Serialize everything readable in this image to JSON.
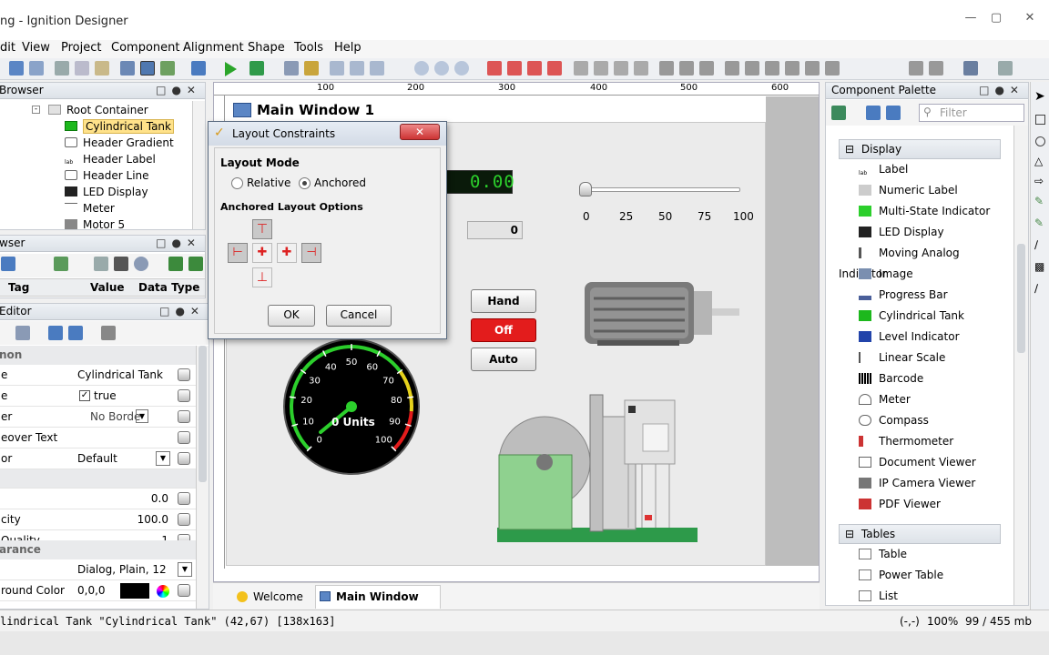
{
  "window": {
    "title": "ng - Ignition Designer"
  },
  "menu": [
    "dit",
    "View",
    "Project",
    "Component",
    "Alignment",
    "Shape",
    "Tools",
    "Help"
  ],
  "project_browser": {
    "title": "Browser",
    "items": [
      "Root Container",
      "Cylindrical Tank",
      "Header Gradient",
      "Header Label",
      "Header Line",
      "LED Display",
      "Meter",
      "Motor 5"
    ]
  },
  "tag_browser": {
    "title": "wser",
    "columns": [
      "Tag",
      "Value",
      "Data Type"
    ]
  },
  "property_editor": {
    "title": "Editor",
    "sections": [
      "non",
      "arance"
    ],
    "rows": [
      {
        "label": "e",
        "value": "Cylindrical Tank"
      },
      {
        "label": "e",
        "value": "true"
      },
      {
        "label": "er",
        "value": "No Borde"
      },
      {
        "label": "eover Text",
        "value": ""
      },
      {
        "label": "or",
        "value": "Default"
      },
      {
        "label": "",
        "value": ""
      },
      {
        "label": "",
        "value": "0.0"
      },
      {
        "label": "city",
        "value": "100.0"
      },
      {
        "label": "Quality",
        "value": "-1"
      },
      {
        "label": "",
        "value": "Dialog, Plain, 12"
      },
      {
        "label": "round Color",
        "value": "0,0,0"
      }
    ]
  },
  "canvas": {
    "window_title": "Main Window 1",
    "ruler_labels": [
      "100",
      "200",
      "300",
      "400",
      "500",
      "600"
    ],
    "led_value": "0.00",
    "numeric_value": "0",
    "slider_ticks": [
      "0",
      "25",
      "50",
      "75",
      "100"
    ],
    "slider_value": 0,
    "hoa_buttons": [
      "Hand",
      "Off",
      "Auto"
    ],
    "meter_ticks": [
      "0",
      "10",
      "20",
      "30",
      "40",
      "50",
      "60",
      "70",
      "80",
      "90",
      "100"
    ],
    "meter_units": "0 Units",
    "tabs": [
      "Welcome",
      "Main Window 1"
    ]
  },
  "dialog": {
    "title": "Layout Constraints",
    "layout_mode_label": "Layout Mode",
    "relative": "Relative",
    "anchored": "Anchored",
    "options_label": "Anchored Layout Options",
    "ok": "OK",
    "cancel": "Cancel"
  },
  "palette": {
    "title": "Component Palette",
    "filter_placeholder": "Filter",
    "display_header": "Display",
    "display_items": [
      "Label",
      "Numeric Label",
      "Multi-State Indicator",
      "LED Display",
      "Moving Analog Indicator",
      "Image",
      "Progress Bar",
      "Cylindrical Tank",
      "Level Indicator",
      "Linear Scale",
      "Barcode",
      "Meter",
      "Compass",
      "Thermometer",
      "Document Viewer",
      "IP Camera Viewer",
      "PDF Viewer"
    ],
    "tables_header": "Tables",
    "table_items": [
      "Table",
      "Power Table",
      "List"
    ]
  },
  "status": {
    "left": "lindrical Tank \"Cylindrical Tank\" (42,67) [138x163]",
    "coords": "(-,-)",
    "zoom": "100%",
    "memory": "99 / 455 mb"
  },
  "colors": {
    "accent_red": "#e31c1c",
    "led_green": "#2ccf2c",
    "tank_green": "#1db81d",
    "selection": "#ffe28a"
  }
}
